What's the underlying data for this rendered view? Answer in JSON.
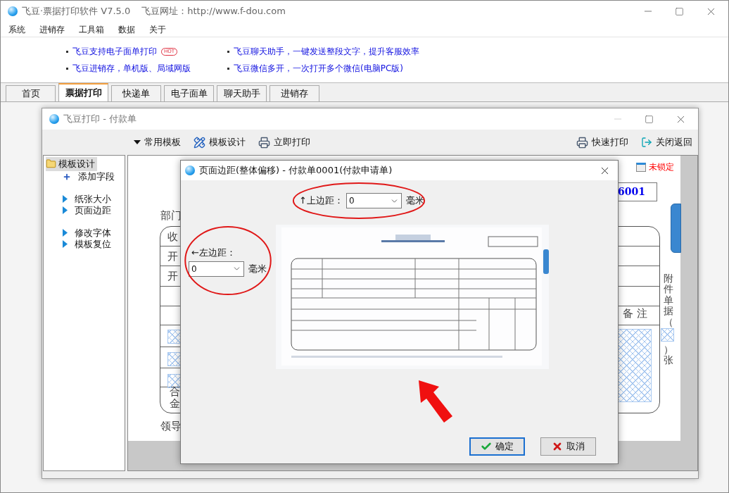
{
  "window": {
    "title": "飞豆·票据打印软件 V7.5.0",
    "site": "飞豆网址：http://www.f-dou.com"
  },
  "menu": [
    "系统",
    "进销存",
    "工具箱",
    "数据",
    "关于"
  ],
  "promos": [
    {
      "text": "飞豆支持电子面单打印",
      "badge": "HOT"
    },
    {
      "text": "飞豆聊天助手，一键发送整段文字，提升客服效率"
    },
    {
      "text": "飞豆进销存，单机版、局域网版"
    },
    {
      "text": "飞豆微信多开，一次打开多个微信(电脑PC版)"
    }
  ],
  "tabs": [
    {
      "label": "首页",
      "selected": false
    },
    {
      "label": "票据打印",
      "selected": true
    },
    {
      "label": "快递单",
      "selected": false
    },
    {
      "label": "电子面单",
      "selected": false
    },
    {
      "label": "聊天助手",
      "selected": false
    },
    {
      "label": "进销存",
      "selected": false
    }
  ],
  "print_window": {
    "title": "飞豆打印 - 付款单",
    "toolbar_left": [
      {
        "kind": "dropdown",
        "label": "常用模板"
      },
      {
        "kind": "design",
        "label": "模板设计"
      },
      {
        "kind": "print",
        "label": "立即打印"
      }
    ],
    "toolbar_right": [
      {
        "kind": "print",
        "label": "快速打印"
      },
      {
        "kind": "exit",
        "label": "关闭返回"
      }
    ],
    "tree": {
      "label": "模板设计",
      "selected": true,
      "sections": [
        {
          "items": [
            {
              "label": "添加字段",
              "kind": "add"
            }
          ]
        },
        {
          "items": [
            {
              "label": "纸张大小",
              "kind": "action"
            },
            {
              "label": "页面边距",
              "kind": "action"
            }
          ]
        },
        {
          "items": [
            {
              "label": "修改字体",
              "kind": "action"
            },
            {
              "label": "模板复位",
              "kind": "action"
            }
          ]
        }
      ]
    },
    "template": {
      "lock_status": "未锁定",
      "number": "6001",
      "department_label": "部门",
      "row_labels": [
        "收",
        "开",
        "开"
      ],
      "total_label": [
        "合",
        "金"
      ],
      "remark_header": "备 注",
      "attachment_label": "附件单据（",
      "attachment_suffix": "）张",
      "leader_label": "领导"
    }
  },
  "dialog": {
    "title": "页面边距(整体偏移) - 付款单0001(付款申请单)",
    "top_margin": {
      "label": "↑上边距：",
      "value": "0",
      "unit": "毫米"
    },
    "left_margin": {
      "label": "←左边距：",
      "value": "0",
      "unit": "毫米"
    },
    "buttons": [
      {
        "label": "确定",
        "kind": "ok",
        "default": true
      },
      {
        "label": "取消",
        "kind": "cancel",
        "default": false
      }
    ]
  }
}
